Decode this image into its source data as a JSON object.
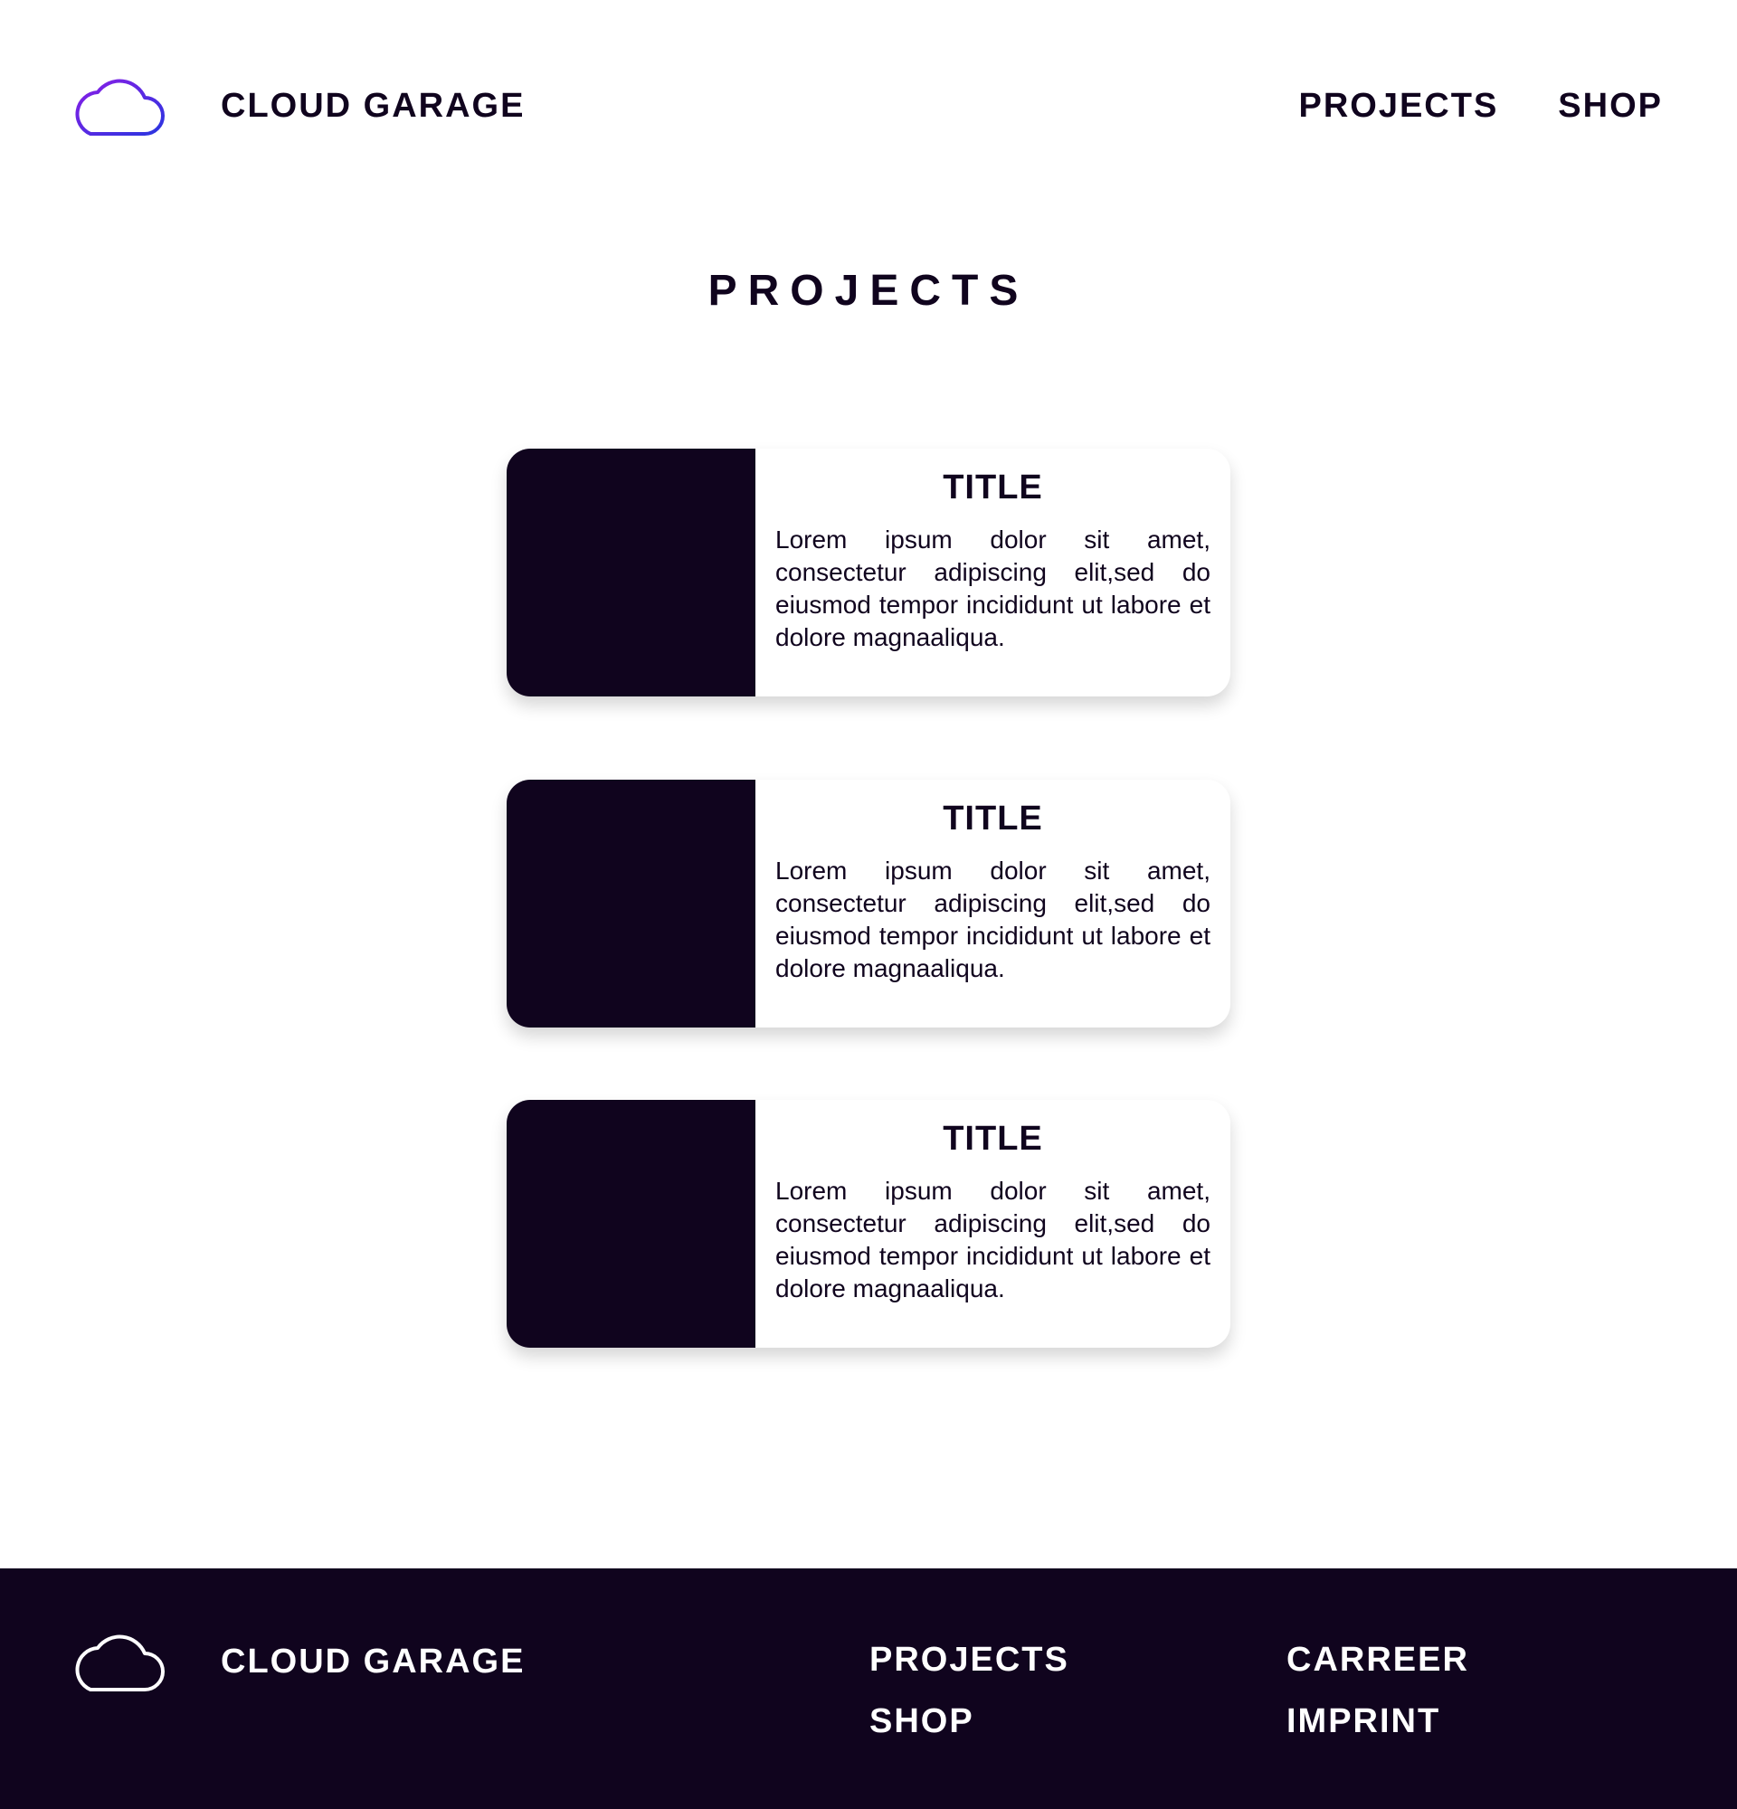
{
  "header": {
    "brand": "CLOUD GARAGE",
    "nav": [
      "PROJECTS",
      "SHOP"
    ]
  },
  "main": {
    "title": "PROJECTS",
    "cards": [
      {
        "title": "TITLE",
        "text": "Lorem ipsum dolor sit amet, consectetur adipiscing elit,sed do eiusmod tempor incididunt ut labore et dolore magnaaliqua."
      },
      {
        "title": "TITLE",
        "text": "Lorem ipsum dolor sit amet, consectetur adipiscing elit,sed do eiusmod tempor incididunt ut labore et dolore magnaaliqua."
      },
      {
        "title": "TITLE",
        "text": "Lorem ipsum dolor sit amet, consectetur adipiscing elit,sed do eiusmod tempor incididunt ut labore et dolore magnaaliqua."
      }
    ]
  },
  "footer": {
    "brand": "CLOUD GARAGE",
    "col1": [
      "PROJECTS",
      "SHOP"
    ],
    "col2": [
      "CARREER",
      "IMPRINT"
    ]
  },
  "icons": {
    "header_logo": "cloud-icon",
    "footer_logo": "cloud-icon"
  },
  "colors": {
    "dark": "#10041e",
    "logo_gradient_start": "#8a1ee6",
    "logo_gradient_end": "#2a35e0",
    "background": "#ffffff"
  }
}
